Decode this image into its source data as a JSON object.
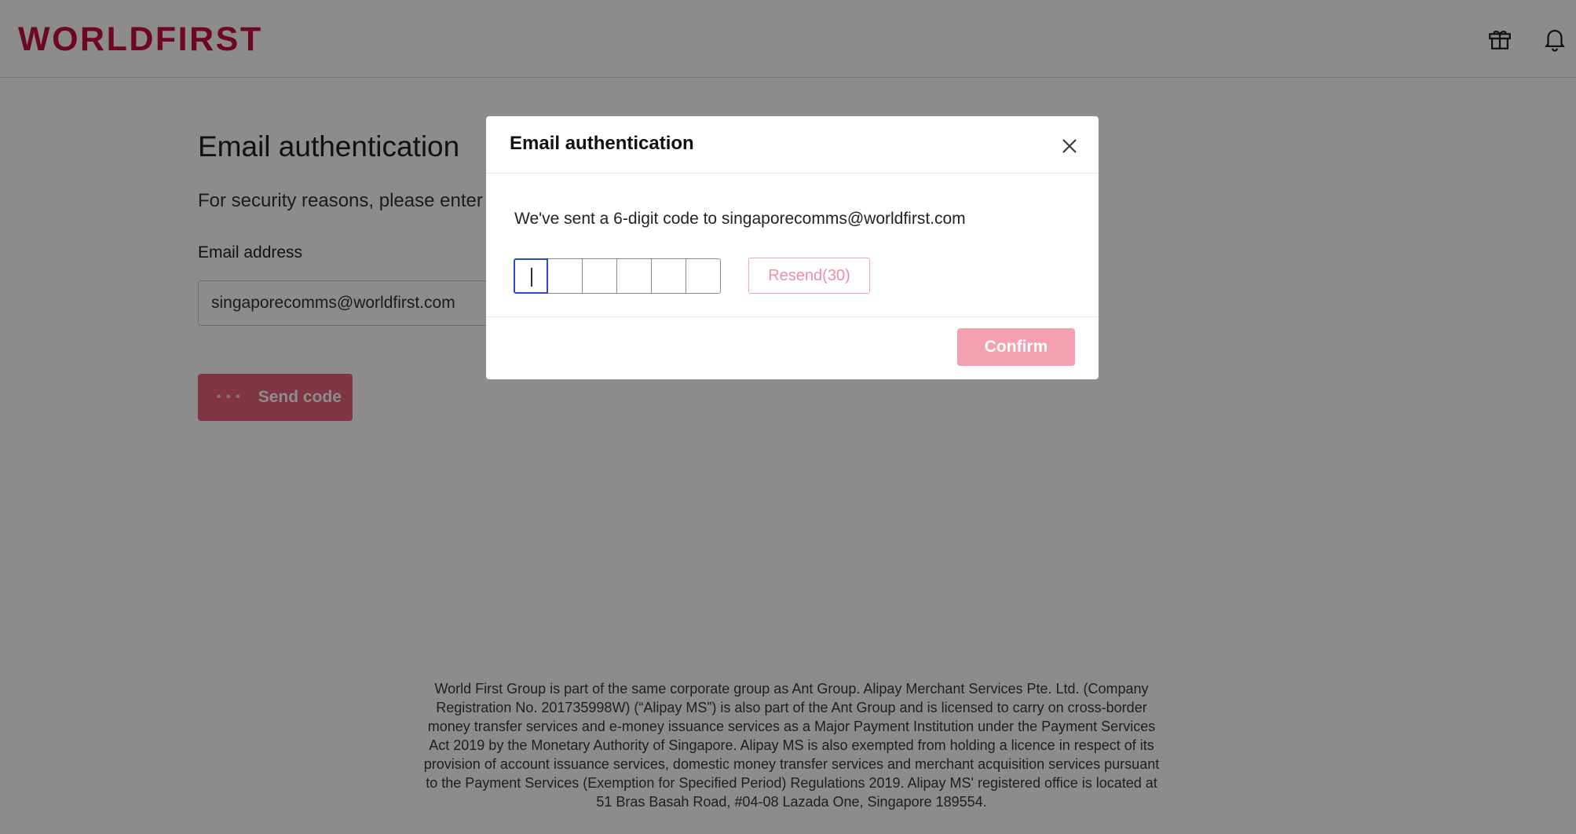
{
  "header": {
    "logo_text": "WORLDFIRST",
    "gift_icon": "gift-icon",
    "bell_icon": "bell-icon"
  },
  "page": {
    "title": "Email authentication",
    "description": "For security reasons, please enter",
    "email_label": "Email address",
    "email_value": "singaporecomms@worldfirst.com",
    "send_button_label": "Send code",
    "send_button_dots": "• • •"
  },
  "modal": {
    "title": "Email authentication",
    "close_icon": "close-icon",
    "message": "We've sent a 6-digit code to singaporecomms@worldfirst.com",
    "code_length": 6,
    "resend_label": "Resend(30)",
    "confirm_label": "Confirm"
  },
  "footer": {
    "text": "World First Group is part of the same corporate group as Ant Group. Alipay Merchant Services Pte. Ltd. (Company Registration No. 201735998W) (“Alipay MS”) is also part of the Ant Group and is licensed to carry on cross-border money transfer services and e-money issuance services as a Major Payment Institution under the Payment Services Act 2019 by the Monetary Authority of Singapore. Alipay MS is also exempted from holding a licence in respect of its provision of account issuance services, domestic money transfer services and merchant acquisition services pursuant to the Payment Services (Exemption for Specified Period) Regulations 2019. Alipay MS' registered office is located at 51 Bras Basah Road, #04-08 Lazada One, Singapore 189554."
  },
  "colors": {
    "brand": "#c8103e",
    "overlay": "rgba(0,0,0,0.45)",
    "primary_disabled": "#f5a0b0",
    "focus": "#2b4acb"
  }
}
